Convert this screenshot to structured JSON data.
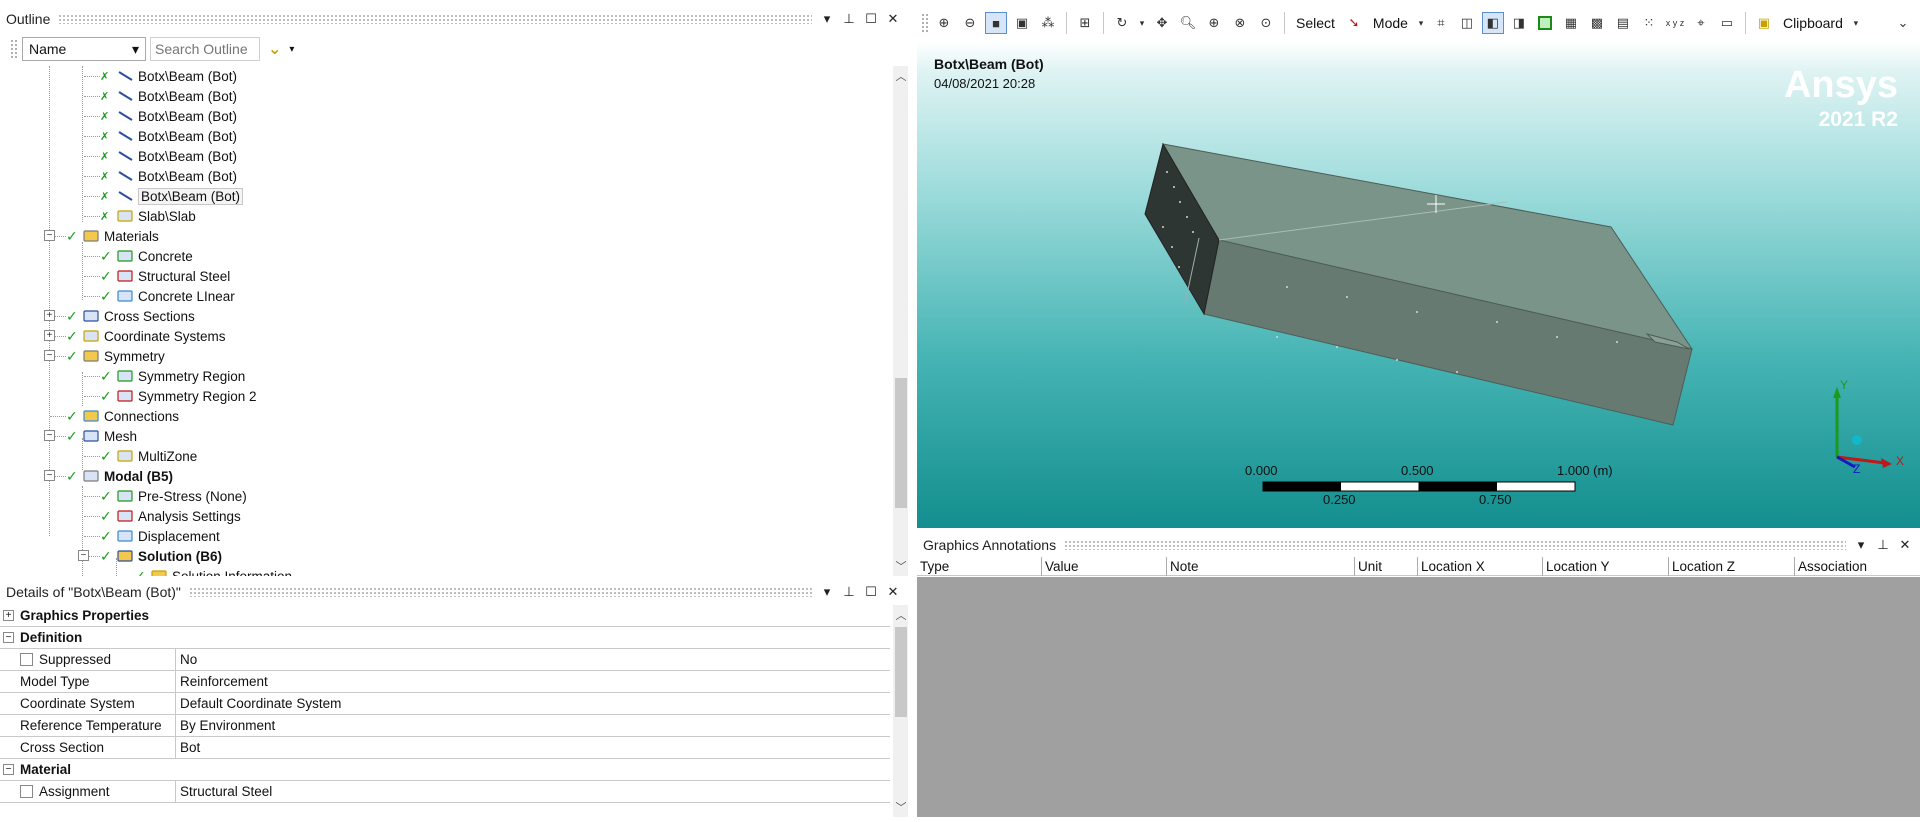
{
  "outline": {
    "title": "Outline",
    "name_combo": "Name",
    "search_placeholder": "Search Outline",
    "controls": [
      "▾",
      "📌",
      "☐",
      "✕"
    ],
    "tree": [
      {
        "label": "Botx\\Beam (Bot)",
        "icon": "beam-icon"
      },
      {
        "label": "Botx\\Beam (Bot)",
        "icon": "beam-icon"
      },
      {
        "label": "Botx\\Beam (Bot)",
        "icon": "beam-icon"
      },
      {
        "label": "Botx\\Beam (Bot)",
        "icon": "beam-icon"
      },
      {
        "label": "Botx\\Beam (Bot)",
        "icon": "beam-icon"
      },
      {
        "label": "Botx\\Beam (Bot)",
        "icon": "beam-icon"
      },
      {
        "label": "Botx\\Beam (Bot)",
        "icon": "beam-icon"
      },
      {
        "label": "Slab\\Slab",
        "icon": "solid-body-icon"
      },
      {
        "label": "Materials",
        "icon": "materials-folder-icon"
      },
      {
        "label": "Concrete",
        "icon": "material-icon"
      },
      {
        "label": "Structural Steel",
        "icon": "material-icon"
      },
      {
        "label": "Concrete LInear",
        "icon": "material-icon"
      },
      {
        "label": "Cross Sections",
        "icon": "cross-section-icon"
      },
      {
        "label": "Coordinate Systems",
        "icon": "coordinate-system-icon"
      },
      {
        "label": "Symmetry",
        "icon": "symmetry-folder-icon"
      },
      {
        "label": "Symmetry Region",
        "icon": "symmetry-region-icon"
      },
      {
        "label": "Symmetry Region 2",
        "icon": "symmetry-region-icon"
      },
      {
        "label": "Connections",
        "icon": "connections-icon"
      },
      {
        "label": "Mesh",
        "icon": "mesh-icon"
      },
      {
        "label": "MultiZone",
        "icon": "multizone-icon"
      },
      {
        "label": "Modal (B5)",
        "icon": "modal-analysis-icon"
      },
      {
        "label": "Pre-Stress (None)",
        "icon": "prestress-icon"
      },
      {
        "label": "Analysis Settings",
        "icon": "analysis-settings-icon"
      },
      {
        "label": "Displacement",
        "icon": "displacement-icon"
      },
      {
        "label": "Solution (B6)",
        "icon": "solution-icon"
      },
      {
        "label": "Solution Information",
        "icon": "solution-information-icon"
      }
    ]
  },
  "details": {
    "title": "Details of \"Botx\\Beam (Bot)\"",
    "groups": {
      "graphics": "Graphics Properties",
      "definition": "Definition",
      "material": "Material"
    },
    "rows": {
      "suppressed": {
        "k": "Suppressed",
        "v": "No"
      },
      "model_type": {
        "k": "Model Type",
        "v": "Reinforcement"
      },
      "coord_sys": {
        "k": "Coordinate System",
        "v": "Default Coordinate System"
      },
      "ref_temp": {
        "k": "Reference Temperature",
        "v": "By Environment"
      },
      "cross_section": {
        "k": "Cross Section",
        "v": "Bot"
      },
      "assignment": {
        "k": "Assignment",
        "v": "Structural Steel"
      }
    }
  },
  "toolbar": {
    "select": "Select",
    "mode": "Mode",
    "clipboard": "Clipboard",
    "xyz": "x y z"
  },
  "viewport": {
    "title": "Botx\\Beam (Bot)",
    "date": "04/08/2021 20:28",
    "brand": "Ansys",
    "version": "2021 R2",
    "scale_top": [
      "0.000",
      "0.500",
      "1.000 (m)"
    ],
    "scale_bottom": [
      "0.250",
      "0.750"
    ],
    "triad": {
      "x": "X",
      "y": "Y",
      "z": "Z"
    }
  },
  "annotations": {
    "title": "Graphics Annotations",
    "columns": [
      "Type",
      "Value",
      "Note",
      "Unit",
      "Location X",
      "Location Y",
      "Location Z",
      "Association"
    ]
  },
  "colors": {
    "check": "#1a9a1a",
    "viewport_bottom": "#138e8e",
    "annotation_bg": "#a0a0a0"
  }
}
